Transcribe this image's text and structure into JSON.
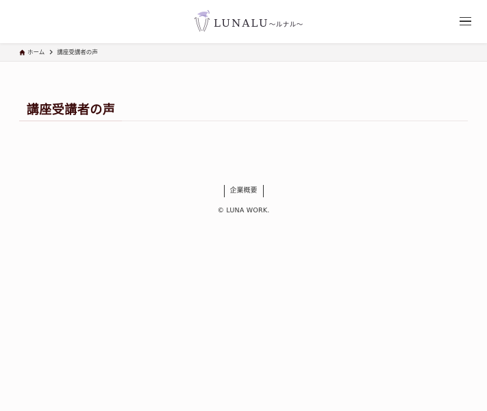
{
  "header": {
    "logo_text": "LUNALU",
    "logo_subtext": "〜ルナル〜",
    "logo_icon": "crescent-moon-hands-icon",
    "menu_icon": "hamburger-menu-icon"
  },
  "breadcrumb": {
    "home_label": "ホーム",
    "home_icon": "home-icon",
    "separator_icon": "chevron-right-icon",
    "current_label": "講座受講者の声"
  },
  "main": {
    "title": "講座受講者の声"
  },
  "footer": {
    "nav_links": [
      "企業概要"
    ],
    "copyright": "© LUNA WORK."
  },
  "colors": {
    "title_text": "#3a0a0a",
    "logo_accent": "#b6a8d8",
    "background": "#fdfcfc",
    "breadcrumb_bg": "#f5f4f4"
  }
}
